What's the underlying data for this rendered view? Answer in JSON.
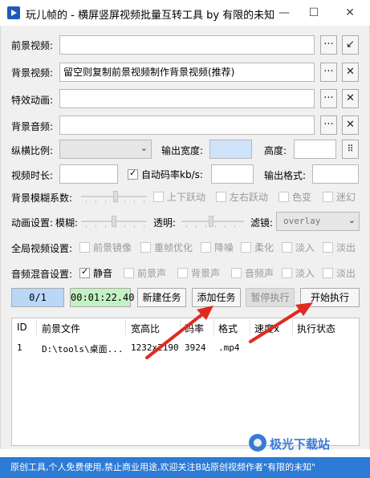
{
  "window": {
    "title": "玩儿帧的 - 横屏竖屏视频批量互转工具  by 有限的未知",
    "minimize": "—",
    "maximize": "☐",
    "close": "✕"
  },
  "row_foreground": {
    "label": "前景视频:",
    "value": "",
    "browse": "···",
    "extra": "↙"
  },
  "row_background": {
    "label": "背景视频:",
    "value": "留空则复制前景视频制作背景视频(推荐)",
    "browse": "···",
    "clear": "✕"
  },
  "row_effect": {
    "label": "特效动画:",
    "value": "",
    "browse": "···",
    "clear": "✕"
  },
  "row_bgaudio": {
    "label": "背景音频:",
    "value": "",
    "browse": "···",
    "clear": "✕"
  },
  "row_ratio": {
    "label": "纵横比例:",
    "combo_value": "",
    "width_label": "输出宽度:",
    "width_value": "",
    "height_label": "高度:",
    "height_value": "",
    "swap": "⠿"
  },
  "row_duration": {
    "label": "视频时长:",
    "duration_value": "",
    "auto_bitrate_label": "自动码率kb/s:",
    "bitrate_value": "",
    "format_label": "输出格式:",
    "format_value": ""
  },
  "row_blur": {
    "label": "背景模糊系数:",
    "opt1": "上下跃动",
    "opt2": "左右跃动",
    "opt3": "色变",
    "opt4": "迷幻"
  },
  "row_anim": {
    "label": "动画设置:",
    "blur_label": "模糊:",
    "alpha_label": "透明:",
    "filter_label": "滤镜:",
    "filter_value": "overlay"
  },
  "row_global": {
    "label": "全局视频设置:",
    "opt1": "前景镜像",
    "opt2": "重帧优化",
    "opt3": "降噪",
    "opt4": "柔化",
    "opt5": "淡入",
    "opt6": "淡出"
  },
  "row_audio": {
    "label": "音频混音设置:",
    "opt_mute": "静音",
    "opt1": "前景声",
    "opt2": "背景声",
    "opt3": "音频声",
    "opt4": "淡入",
    "opt5": "淡出"
  },
  "actions": {
    "progress": "0/1",
    "elapsed": "00:01:22.40",
    "new_task": "新建任务",
    "add_task": "添加任务",
    "pause": "暂停执行",
    "start": "开始执行"
  },
  "table": {
    "headers": [
      "ID",
      "前景文件",
      "宽高比",
      "码率",
      "格式",
      "速度x",
      "执行状态"
    ],
    "rows": [
      {
        "id": "1",
        "file": "D:\\tools\\桌面...",
        "ratio": "1232x2190",
        "bitrate": "3924",
        "format": ".mp4",
        "speed": "",
        "status": ""
      }
    ]
  },
  "footer": "原创工具,个人免费使用,禁止商业用途,欢迎关注B站原创视频作者\"有限的未知\"",
  "watermark": "极光下载站",
  "colors": {
    "progress_bg": "#b9d7f7",
    "elapsed_bg": "#c4f2c4",
    "width_field_bg": "#cfe3fb",
    "footer_bg": "#2c7bd5",
    "annotation_arrow": "#e02a1f"
  }
}
